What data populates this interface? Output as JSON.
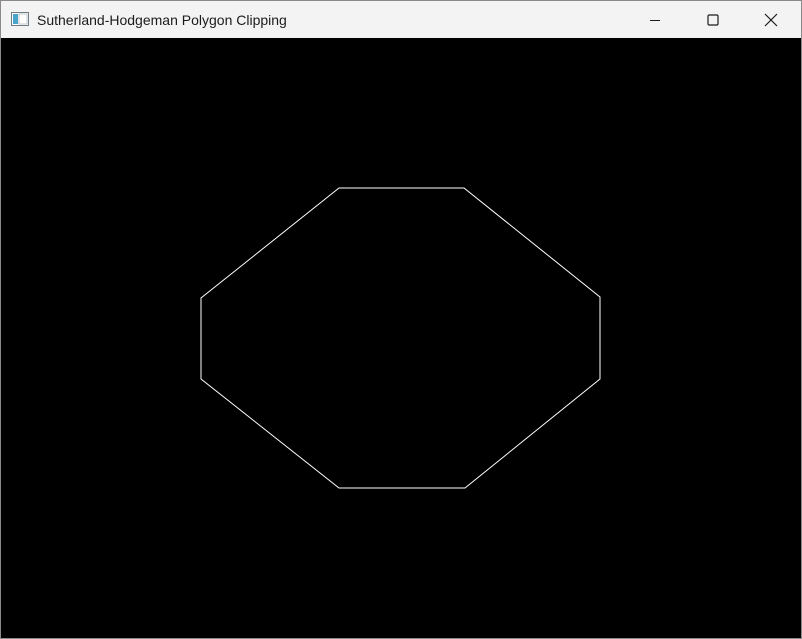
{
  "window": {
    "title": "Sutherland-Hodgeman Polygon Clipping",
    "controls": {
      "minimize_icon": "minimize-icon",
      "maximize_icon": "maximize-icon",
      "close_icon": "close-icon"
    },
    "app_icon": "window-app-icon"
  },
  "canvas": {
    "background_color": "#000000",
    "stroke_color": "#ffffff"
  }
}
